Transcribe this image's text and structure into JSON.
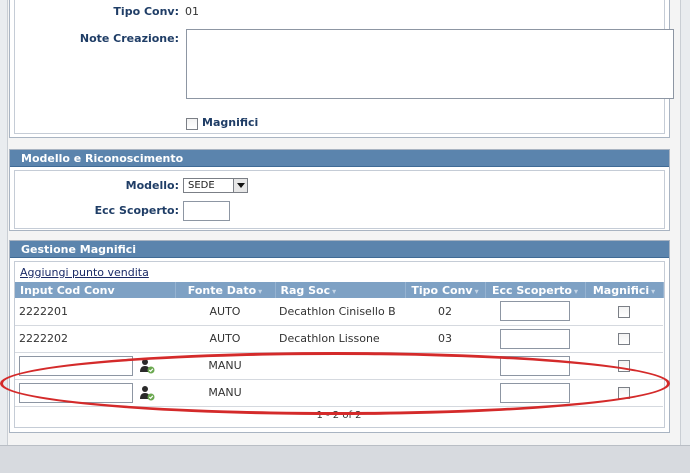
{
  "details": {
    "tipo_conv_label": "Tipo Conv:",
    "tipo_conv_value": "01",
    "note_label": "Note Creazione:",
    "note_value": "",
    "magnifici_label": "Magnifici"
  },
  "modello_section": {
    "title": "Modello e Riconoscimento",
    "modello_label": "Modello:",
    "modello_value": "SEDE",
    "ecc_label": "Ecc Scoperto:",
    "ecc_value": ""
  },
  "gestione_section": {
    "title": "Gestione Magnifici",
    "add_link": "Aggiungi punto vendita",
    "columns": [
      "Input Cod Conv",
      "Fonte Dato",
      "Rag Soc",
      "Tipo Conv",
      "Ecc Scoperto",
      "Magnifici"
    ],
    "rows": [
      {
        "cod": "2222201",
        "fonte": "AUTO",
        "rag": "Decathlon Cinisello B",
        "tipo": "02"
      },
      {
        "cod": "2222202",
        "fonte": "AUTO",
        "rag": "Decathlon Lissone",
        "tipo": "03"
      },
      {
        "cod": "",
        "fonte": "MANU",
        "rag": "",
        "tipo": ""
      },
      {
        "cod": "",
        "fonte": "MANU",
        "rag": "",
        "tipo": ""
      }
    ],
    "pager": "1 - 2 of 2"
  },
  "colors": {
    "header_bar": "#5b84ad",
    "grid_header": "#7ea1c4",
    "highlight": "#d42a2a"
  }
}
